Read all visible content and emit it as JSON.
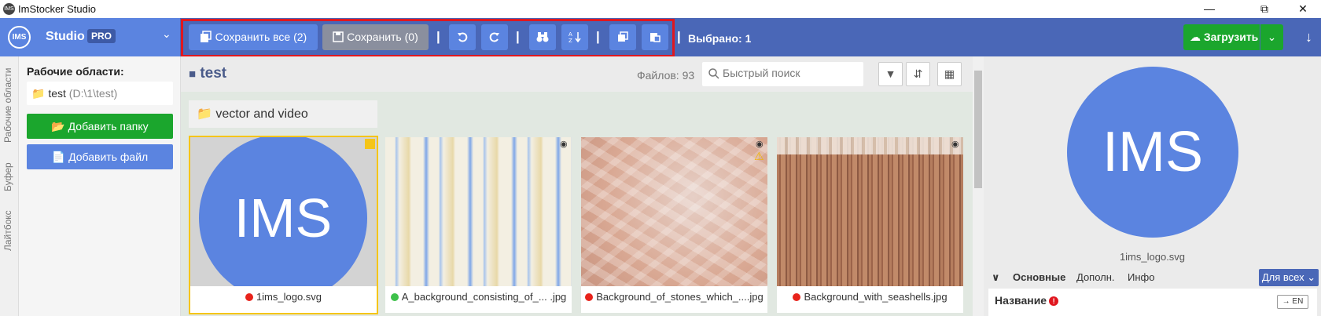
{
  "window": {
    "title": "ImStocker Studio",
    "icon_text": "IMS"
  },
  "brand": {
    "logo": "IMS",
    "name": "Studio",
    "badge": "PRO"
  },
  "toolbar": {
    "save_all": "Сохранить все (2)",
    "save": "Сохранить (0)",
    "separator": "|",
    "selected": "Выбрано: 1",
    "upload": "Загрузить",
    "arrow": "↓"
  },
  "vertical_tabs": [
    "Рабочие области",
    "Буфер",
    "Лайтбокс"
  ],
  "left_panel": {
    "title": "Рабочие области:",
    "workspace": {
      "name": "test",
      "path": "(D:\\1\\test)"
    },
    "add_folder": "Добавить папку",
    "add_file": "Добавить файл"
  },
  "center": {
    "folder_title": "test",
    "files_count": "Файлов: 93",
    "search_placeholder": "Быстрый поиск",
    "subfolder": "vector and video",
    "cards": [
      {
        "name": "1ims_logo.svg",
        "status_color": "#e8231b",
        "logo": "IMS"
      },
      {
        "name": "A_background_consisting_of_... .jpg",
        "status_color": "#3ec14b"
      },
      {
        "name": "Background_of_stones_which_....jpg",
        "status_color": "#e8231b"
      },
      {
        "name": "Background_with_seashells.jpg",
        "status_color": "#e8231b"
      }
    ]
  },
  "right_panel": {
    "preview_logo": "IMS",
    "preview_name": "1ims_logo.svg",
    "tabs": [
      "Основные",
      "Дополн.",
      "Инфо"
    ],
    "for_all": "Для всех",
    "field_label": "Название",
    "lang_btn": "→ EN"
  }
}
